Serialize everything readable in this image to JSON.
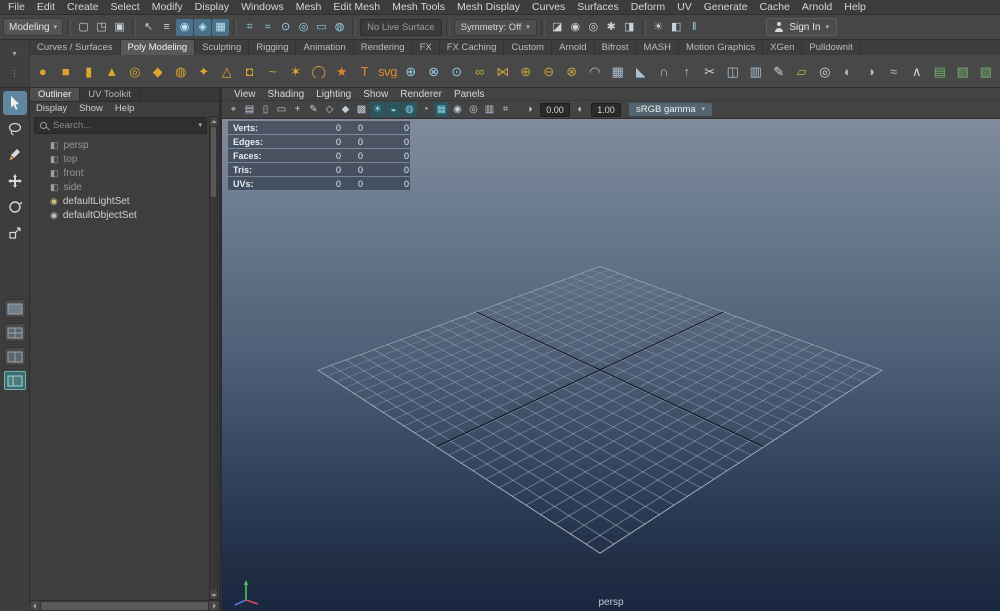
{
  "ui": {
    "caret_down": "▾",
    "overflow_dots": "⋮",
    "exposure_icon_glyph": "◑",
    "gamma_icon_glyph": "◐"
  },
  "menubar": {
    "items": [
      "File",
      "Edit",
      "Create",
      "Select",
      "Modify",
      "Display",
      "Windows",
      "Mesh",
      "Edit Mesh",
      "Mesh Tools",
      "Mesh Display",
      "Curves",
      "Surfaces",
      "Deform",
      "UV",
      "Generate",
      "Cache",
      "Arnold",
      "Help"
    ]
  },
  "statusline": {
    "menuset_value": "Modeling",
    "file_icons": [
      {
        "name": "new-scene-icon",
        "glyph": "▢",
        "color": "#c9d1d9"
      },
      {
        "name": "open-scene-icon",
        "glyph": "◳",
        "color": "#c9d1d9"
      },
      {
        "name": "save-scene-icon",
        "glyph": "▣",
        "color": "#c9d1d9"
      }
    ],
    "selection_icons": [
      {
        "name": "select-tool-context-icon",
        "glyph": "↖",
        "color": "#c9d1d9"
      },
      {
        "name": "select-by-hierarchy-icon",
        "glyph": "≡",
        "color": "#c9d1d9"
      },
      {
        "name": "select-by-object-icon",
        "glyph": "◉",
        "color": "#bfe3f2",
        "on": true
      },
      {
        "name": "select-by-component-icon",
        "glyph": "◈",
        "color": "#bfe3f2",
        "on": true
      },
      {
        "name": "highlight-selection-mode-icon",
        "glyph": "▦",
        "color": "#bfe3f2",
        "on": true
      }
    ],
    "snap_icons": [
      {
        "name": "snap-to-grids-icon",
        "glyph": "⌗",
        "color": "#8fd2e4"
      },
      {
        "name": "snap-to-curves-icon",
        "glyph": "≈",
        "color": "#8fd2e4"
      },
      {
        "name": "snap-to-points-icon",
        "glyph": "⊙",
        "color": "#8fd2e4"
      },
      {
        "name": "snap-to-projected-center-icon",
        "glyph": "◎",
        "color": "#8fd2e4"
      },
      {
        "name": "snap-to-view-planes-icon",
        "glyph": "▭",
        "color": "#8fd2e4"
      },
      {
        "name": "make-live-icon",
        "glyph": "◍",
        "color": "#8fd2e4"
      }
    ],
    "live_surface_label": "No Live Surface",
    "symmetry_value": "Symmetry: Off",
    "render_icons": [
      {
        "name": "open-render-view-icon",
        "glyph": "◪",
        "color": "#c9d1d9"
      },
      {
        "name": "render-current-frame-icon",
        "glyph": "◉",
        "color": "#c9d1d9"
      },
      {
        "name": "ipr-render-icon",
        "glyph": "◎",
        "color": "#c9d1d9"
      },
      {
        "name": "render-settings-icon",
        "glyph": "✱",
        "color": "#c9d1d9"
      },
      {
        "name": "hypershade-icon",
        "glyph": "◨",
        "color": "#c9d1d9"
      }
    ],
    "display_icons": [
      {
        "name": "light-editor-icon",
        "glyph": "☀",
        "color": "#c9d1d9"
      },
      {
        "name": "lookdev-view-icon",
        "glyph": "◧",
        "color": "#c9d1d9"
      },
      {
        "name": "pause-viewport-icon",
        "glyph": "‖",
        "color": "#8fd2e4"
      }
    ],
    "signin_label": "Sign In"
  },
  "shelf": {
    "tabs": [
      {
        "label": "Curves / Surfaces"
      },
      {
        "label": "Poly Modeling",
        "active": true
      },
      {
        "label": "Sculpting"
      },
      {
        "label": "Rigging"
      },
      {
        "label": "Animation"
      },
      {
        "label": "Rendering"
      },
      {
        "label": "FX"
      },
      {
        "label": "FX Caching"
      },
      {
        "label": "Custom"
      },
      {
        "label": "Arnold"
      },
      {
        "label": "Bifrost"
      },
      {
        "label": "MASH"
      },
      {
        "label": "Motion Graphics"
      },
      {
        "label": "XGen"
      },
      {
        "label": "Pulldownit"
      }
    ],
    "icons": [
      {
        "name": "poly-sphere-icon",
        "glyph": "●",
        "color": "#dca62d"
      },
      {
        "name": "poly-cube-icon",
        "glyph": "■",
        "color": "#dca62d"
      },
      {
        "name": "poly-cylinder-icon",
        "glyph": "▮",
        "color": "#dca62d"
      },
      {
        "name": "poly-cone-icon",
        "glyph": "▲",
        "color": "#dca62d"
      },
      {
        "name": "poly-torus-icon",
        "glyph": "◎",
        "color": "#dca62d"
      },
      {
        "name": "poly-plane-icon",
        "glyph": "◆",
        "color": "#dca62d"
      },
      {
        "name": "poly-disc-icon",
        "glyph": "◍",
        "color": "#dca62d"
      },
      {
        "name": "poly-platonic-icon",
        "glyph": "✦",
        "color": "#dca62d"
      },
      {
        "name": "poly-pyramid-icon",
        "glyph": "△",
        "color": "#dca62d"
      },
      {
        "name": "poly-pipe-icon",
        "glyph": "◘",
        "color": "#dca62d"
      },
      {
        "name": "poly-helix-icon",
        "glyph": "~",
        "color": "#dca62d"
      },
      {
        "name": "poly-gear-icon",
        "glyph": "✶",
        "color": "#dca62d"
      },
      {
        "name": "poly-soccerball-icon",
        "glyph": "◯",
        "color": "#dca62d"
      },
      {
        "name": "sculpt-tool-icon",
        "glyph": "★",
        "color": "#d8832b"
      },
      {
        "name": "type-tool-icon",
        "glyph": "T",
        "color": "#e08a2d"
      },
      {
        "name": "svg-tool-icon",
        "glyph": "svg",
        "color": "#e08a2d"
      },
      {
        "name": "center-pivot-icon",
        "glyph": "⊕",
        "color": "#8fcde0"
      },
      {
        "name": "snap-together-icon",
        "glyph": "⊗",
        "color": "#8fcde0"
      },
      {
        "name": "align-objects-icon",
        "glyph": "⊙",
        "color": "#8fcde0"
      },
      {
        "name": "combine-icon",
        "glyph": "∞",
        "color": "#c9a23a"
      },
      {
        "name": "separate-icon",
        "glyph": "⋈",
        "color": "#c9a23a"
      },
      {
        "name": "boolean-union-icon",
        "glyph": "⊕",
        "color": "#c9a23a"
      },
      {
        "name": "boolean-difference-icon",
        "glyph": "⊖",
        "color": "#c9a23a"
      },
      {
        "name": "boolean-intersection-icon",
        "glyph": "⊗",
        "color": "#c9a23a"
      },
      {
        "name": "smooth-icon",
        "glyph": "◠",
        "color": "#a9bfd2"
      },
      {
        "name": "subdivide-icon",
        "glyph": "▦",
        "color": "#a9bfd2"
      },
      {
        "name": "bevel-icon",
        "glyph": "◣",
        "color": "#a9bfd2"
      },
      {
        "name": "bridge-icon",
        "glyph": "∩",
        "color": "#a9bfd2"
      },
      {
        "name": "extrude-icon",
        "glyph": "↑",
        "color": "#a9bfd2"
      },
      {
        "name": "multi-cut-icon",
        "glyph": "✂",
        "color": "#d0d6dc"
      },
      {
        "name": "insert-edge-loop-icon",
        "glyph": "◫",
        "color": "#a9bfd2"
      },
      {
        "name": "offset-edge-loop-icon",
        "glyph": "▥",
        "color": "#a9bfd2"
      },
      {
        "name": "paint-vertex-icon",
        "glyph": "✎",
        "color": "#d0d6dc"
      },
      {
        "name": "quad-draw-icon",
        "glyph": "▱",
        "color": "#8fc24f"
      },
      {
        "name": "target-weld-icon",
        "glyph": "◎",
        "color": "#d0d6dc"
      },
      {
        "name": "mirror-icon",
        "glyph": "◐",
        "color": "#a9bfd2"
      },
      {
        "name": "symmetrize-icon",
        "glyph": "◑",
        "color": "#a9bfd2"
      },
      {
        "name": "average-vertices-icon",
        "glyph": "≈",
        "color": "#a9bfd2"
      },
      {
        "name": "crease-tool-icon",
        "glyph": "∧",
        "color": "#d0d6dc"
      },
      {
        "name": "uv-planar-map-icon",
        "glyph": "▤",
        "color": "#74b06f"
      },
      {
        "name": "uv-auto-map-icon",
        "glyph": "▨",
        "color": "#74b06f"
      },
      {
        "name": "uv-cylindrical-map-icon",
        "glyph": "▧",
        "color": "#74b06f"
      },
      {
        "name": "uv-editor-icon",
        "glyph": "⌗",
        "color": "#74b06f"
      }
    ]
  },
  "toolbox": {
    "tools": [
      {
        "name": "select-tool",
        "active": true
      },
      {
        "name": "lasso-tool"
      },
      {
        "name": "paint-select-tool"
      },
      {
        "name": "move-tool"
      },
      {
        "name": "rotate-tool"
      },
      {
        "name": "scale-tool"
      }
    ],
    "layouts": [
      {
        "name": "layout-single-pane"
      },
      {
        "name": "layout-four-pane"
      },
      {
        "name": "layout-two-pane"
      },
      {
        "name": "layout-outliner-persp",
        "active": true
      }
    ]
  },
  "outliner": {
    "tabs": [
      {
        "label": "Outliner",
        "active": true
      },
      {
        "label": "UV Toolkit"
      }
    ],
    "menus": [
      "Display",
      "Show",
      "Help"
    ],
    "search_placeholder": "Search...",
    "items": [
      {
        "label": "persp",
        "glyph": "◧",
        "color": "#9aa0a6",
        "dim": true
      },
      {
        "label": "top",
        "glyph": "◧",
        "color": "#9aa0a6",
        "dim": true
      },
      {
        "label": "front",
        "glyph": "◧",
        "color": "#9aa0a6",
        "dim": true
      },
      {
        "label": "side",
        "glyph": "◧",
        "color": "#9aa0a6",
        "dim": true
      },
      {
        "label": "defaultLightSet",
        "glyph": "◉",
        "color": "#d2c27a"
      },
      {
        "label": "defaultObjectSet",
        "glyph": "◉",
        "color": "#c4c4c4"
      }
    ]
  },
  "viewport": {
    "menus": [
      "View",
      "Shading",
      "Lighting",
      "Show",
      "Renderer",
      "Panels"
    ],
    "toolbar_icons": [
      {
        "name": "selected-camera-icon",
        "glyph": "⌖",
        "color": "#c2cdd6"
      },
      {
        "name": "camera-attributes-icon",
        "glyph": "▤",
        "color": "#c2cdd6"
      },
      {
        "name": "bookmarks-icon",
        "glyph": "▯",
        "color": "#c2cdd6"
      },
      {
        "name": "image-plane-icon",
        "glyph": "▭",
        "color": "#c2cdd6"
      },
      {
        "name": "2d-pan-zoom-icon",
        "glyph": "+",
        "color": "#c2cdd6"
      },
      {
        "name": "grease-pencil-icon",
        "glyph": "✎",
        "color": "#c2cdd6"
      },
      {
        "name": "wireframe-icon",
        "glyph": "◇",
        "color": "#c2cdd6"
      },
      {
        "name": "shaded-icon",
        "glyph": "◆",
        "color": "#c2cdd6"
      },
      {
        "name": "textured-icon",
        "glyph": "▩",
        "color": "#c2cdd6"
      },
      {
        "name": "use-all-lights-icon",
        "glyph": "☀",
        "color": "#8fd0e2",
        "on": true
      },
      {
        "name": "shadows-icon",
        "glyph": "◒",
        "color": "#8fd0e2",
        "on": true
      },
      {
        "name": "screen-space-ao-icon",
        "glyph": "◍",
        "color": "#8fd0e2",
        "on": true
      },
      {
        "name": "motion-blur-icon",
        "glyph": "◔",
        "color": "#c2cdd6"
      },
      {
        "name": "multisample-aa-icon",
        "glyph": "▦",
        "color": "#8fd0e2",
        "on": true
      },
      {
        "name": "depth-of-field-icon",
        "glyph": "◉",
        "color": "#c2cdd6"
      },
      {
        "name": "isolate-select-icon",
        "glyph": "◎",
        "color": "#c2cdd6"
      },
      {
        "name": "x-ray-icon",
        "glyph": "▥",
        "color": "#c2cdd6"
      },
      {
        "name": "joints-x-ray-icon",
        "glyph": "⌗",
        "color": "#c2cdd6"
      }
    ],
    "exposure_value": "0.00",
    "gamma_value": "1.00",
    "view_transform": "sRGB gamma",
    "hud_rows": [
      {
        "label": "Verts:",
        "v1": "0",
        "v2": "0",
        "v3": "0"
      },
      {
        "label": "Edges:",
        "v1": "0",
        "v2": "0",
        "v3": "0"
      },
      {
        "label": "Faces:",
        "v1": "0",
        "v2": "0",
        "v3": "0"
      },
      {
        "label": "Tris:",
        "v1": "0",
        "v2": "0",
        "v3": "0"
      },
      {
        "label": "UVs:",
        "v1": "0",
        "v2": "0",
        "v3": "0"
      }
    ],
    "camera_label": "persp"
  }
}
